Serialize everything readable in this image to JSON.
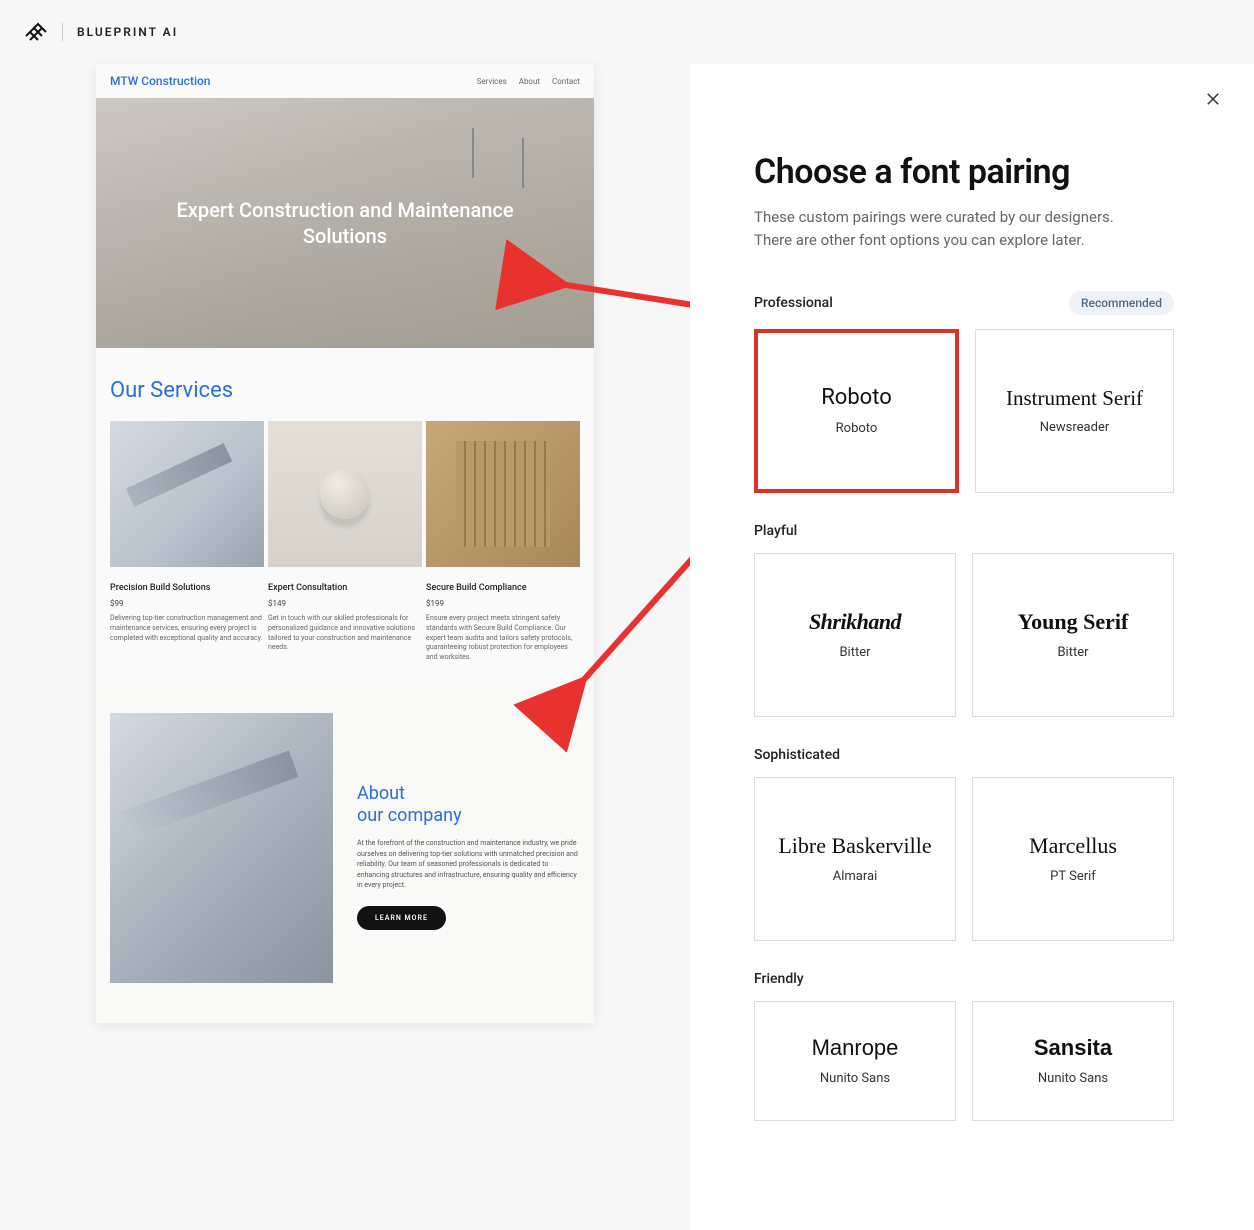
{
  "header": {
    "brand": "BLUEPRINT AI"
  },
  "preview": {
    "site_name": "MTW Construction",
    "nav": {
      "services": "Services",
      "about": "About",
      "contact": "Contact"
    },
    "hero_title": "Expert Construction and Maintenance Solutions",
    "services_heading": "Our Services",
    "services": [
      {
        "name": "Precision Build Solutions",
        "price": "$99",
        "desc": "Delivering top-tier construction management and maintenance services, ensuring every project is completed with exceptional quality and accuracy."
      },
      {
        "name": "Expert Consultation",
        "price": "$149",
        "desc": "Get in touch with our skilled professionals for personalized guidance and innovative solutions tailored to your construction and maintenance needs."
      },
      {
        "name": "Secure Build Compliance",
        "price": "$199",
        "desc": "Ensure every project meets stringent safety standards with Secure Build Compliance. Our expert team audits and tailors safety protocols, guaranteeing robust protection for employees and worksites."
      }
    ],
    "about_heading": "About\nour company",
    "about_para": "At the forefront of the construction and maintenance industry, we pride ourselves on delivering top-tier solutions with unmatched precision and reliability. Our team of seasoned professionals is dedicated to enhancing structures and infrastructure, ensuring quality and efficiency in every project.",
    "learn_more": "LEARN MORE"
  },
  "panel": {
    "title": "Choose a font pairing",
    "subtitle": "These custom pairings were curated by our designers. There are other font options you can explore later.",
    "recommended_badge": "Recommended",
    "categories": {
      "professional": {
        "label": "Professional",
        "cards": [
          {
            "heading": "Roboto",
            "body": "Roboto",
            "selected": true
          },
          {
            "heading": "Instrument Serif",
            "body": "Newsreader",
            "selected": false
          }
        ]
      },
      "playful": {
        "label": "Playful",
        "cards": [
          {
            "heading": "Shrikhand",
            "body": "Bitter"
          },
          {
            "heading": "Young Serif",
            "body": "Bitter"
          }
        ]
      },
      "sophisticated": {
        "label": "Sophisticated",
        "cards": [
          {
            "heading": "Libre Baskerville",
            "body": "Almarai"
          },
          {
            "heading": "Marcellus",
            "body": "PT Serif"
          }
        ]
      },
      "friendly": {
        "label": "Friendly",
        "cards": [
          {
            "heading": "Manrope",
            "body": "Nunito Sans"
          },
          {
            "heading": "Sansita",
            "body": "Nunito Sans"
          }
        ]
      }
    }
  }
}
